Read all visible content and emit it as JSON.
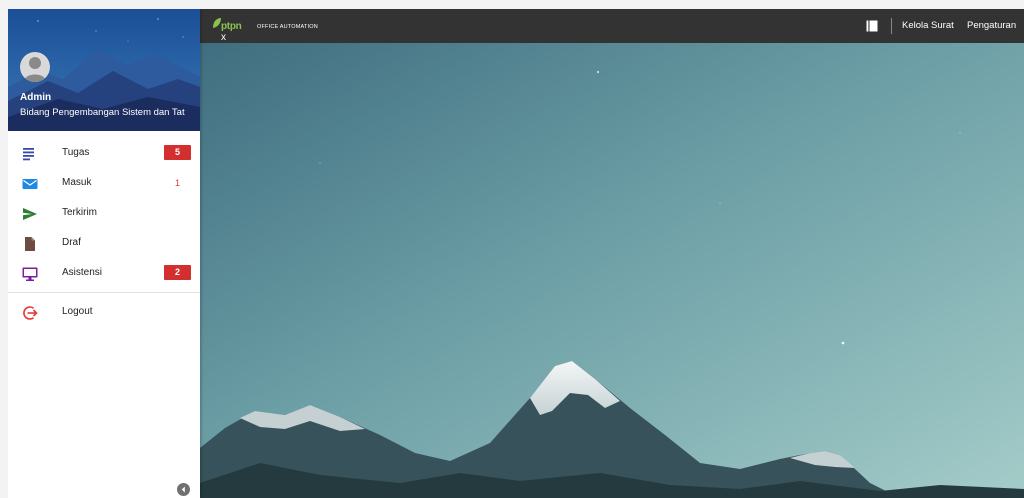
{
  "profile": {
    "name": "Admin",
    "unit": "Bidang Pengembangan Sistem dan Tat"
  },
  "nav": {
    "items": [
      {
        "label": "Tugas",
        "icon": "task-list-icon",
        "badge": "5",
        "badge_style": "box"
      },
      {
        "label": "Masuk",
        "icon": "mail-icon",
        "badge": "1",
        "badge_style": "text"
      },
      {
        "label": "Terkirim",
        "icon": "send-icon"
      },
      {
        "label": "Draf",
        "icon": "draft-file-icon"
      },
      {
        "label": "Asistensi",
        "icon": "monitor-icon",
        "badge": "2",
        "badge_style": "box"
      }
    ],
    "logout_label": "Logout"
  },
  "topbar": {
    "brand_name": "ptpn",
    "brand_suffix": "x",
    "brand_sub": "OFFICE AUTOMATION",
    "kelola_label": "Kelola Surat",
    "pengaturan_label": "Pengaturan"
  },
  "colors": {
    "topbar": "#333333",
    "badge": "#d32f2f",
    "brand_green": "#8bc34a",
    "tugas_icon": "#3949ab",
    "masuk_icon": "#1e88e5",
    "terkirim_icon": "#2e7d32",
    "draf_icon": "#6d4c41",
    "asistensi_icon": "#7b1fa2",
    "logout_icon": "#e53935"
  }
}
